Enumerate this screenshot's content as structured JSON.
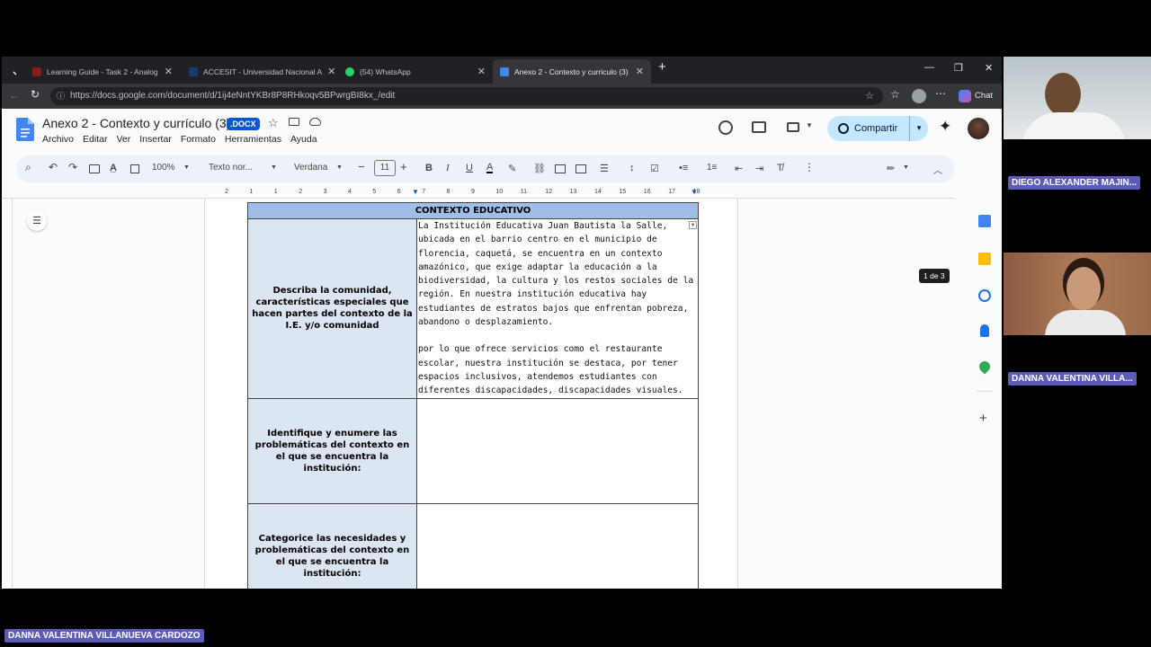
{
  "tabs": [
    {
      "label": "Learning Guide - Task 2 - Analog",
      "favicon_color": "#8a1c1c"
    },
    {
      "label": "ACCESIT - Universidad Nacional A",
      "favicon_color": "#1a3a6e"
    },
    {
      "label": "(54) WhatsApp",
      "favicon_color": "#25d366"
    },
    {
      "label": "Anexo 2 - Contexto y curriculo (3)",
      "favicon_color": "#4285f4",
      "active": true
    }
  ],
  "address": {
    "url": "https://docs.google.com/document/d/1ij4eNntYKBr8P8RHkoqv5BPwrgBI8kx_/edit",
    "chat_label": "Chat"
  },
  "docs": {
    "title": "Anexo 2 - Contexto y currículo (3)",
    "badge": ".DOCX",
    "menu": [
      "Archivo",
      "Editar",
      "Ver",
      "Insertar",
      "Formato",
      "Herramientas",
      "Ayuda"
    ],
    "share_label": "Compartir",
    "toolbar": {
      "zoom": "100%",
      "style": "Texto nor...",
      "font": "Verdana",
      "font_size": "11"
    },
    "ruler_ticks": [
      "2",
      "1",
      "1",
      "2",
      "3",
      "4",
      "5",
      "6",
      "7",
      "8",
      "9",
      "10",
      "11",
      "12",
      "13",
      "14",
      "15",
      "16",
      "17",
      "18"
    ],
    "page_counter": "1 de 3"
  },
  "table": {
    "header": "CONTEXTO EDUCATIVO",
    "rows": [
      {
        "question": "Describa la comunidad, características especiales que hacen partes del contexto de la I.E. y/o comunidad",
        "answer_p1": "La Institución Educativa Juan Bautista la Salle, ubicada en el barrio centro en  el municipio de florencia, caquetá, se encuentra en un contexto amazónico, que exige adaptar la educación a la biodiversidad, la cultura y los restos sociales de la región. En nuestra institución educativa hay estudiantes de estratos bajos que enfrentan pobreza, abandono o desplazamiento.",
        "answer_p2": "por lo que ofrece servicios como el restaurante escolar, nuestra institución se destaca, por tener espacios inclusivos, atendemos estudiantes con diferentes discapacidades, discapacidades visuales."
      },
      {
        "question": "Identifique y enumere las problemáticas del contexto en el que se encuentra la institución:",
        "answer_p1": "",
        "answer_p2": ""
      },
      {
        "question": "Categorice las necesidades y problemáticas del contexto en el que se encuentra la institución:",
        "answer_p1": "",
        "answer_p2": ""
      }
    ]
  },
  "participants": [
    {
      "name": "DIEGO ALEXANDER MAJIN..."
    },
    {
      "name": "DANNA VALENTINA VILLA..."
    }
  ],
  "speaker_name": "DANNA VALENTINA VILLANUEVA CARDOZO",
  "colors": {
    "accent": "#0b57d0",
    "share_bg": "#c2e7ff",
    "table_header": "#9fbfe8",
    "question_cell": "#dce6f2",
    "nametag": "#5c5cb8"
  }
}
